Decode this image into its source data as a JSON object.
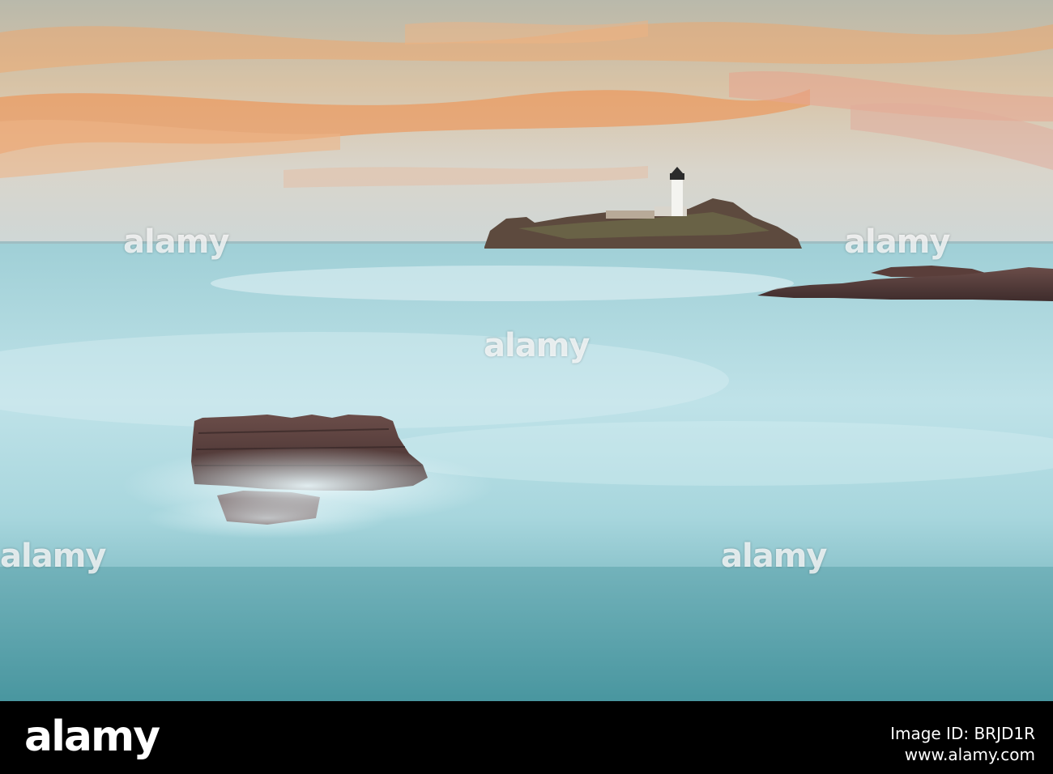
{
  "photo": {
    "subject": "",
    "colors": {
      "sky_top": "#c9c6b8",
      "sky_orange": "#f29a5a",
      "sky_pink": "#e9a48e",
      "sea_light": "#cfe9ee",
      "sea_mid": "#8cc7cf",
      "sea_deep": "#4d9aa5",
      "rock": "#5a3e3a",
      "lighthouse": "#f4f4f0"
    }
  },
  "watermark": {
    "text": "alamy"
  },
  "footer": {
    "logo": "alamy",
    "image_id": "Image ID: BRJD1R",
    "url": "www.alamy.com"
  }
}
